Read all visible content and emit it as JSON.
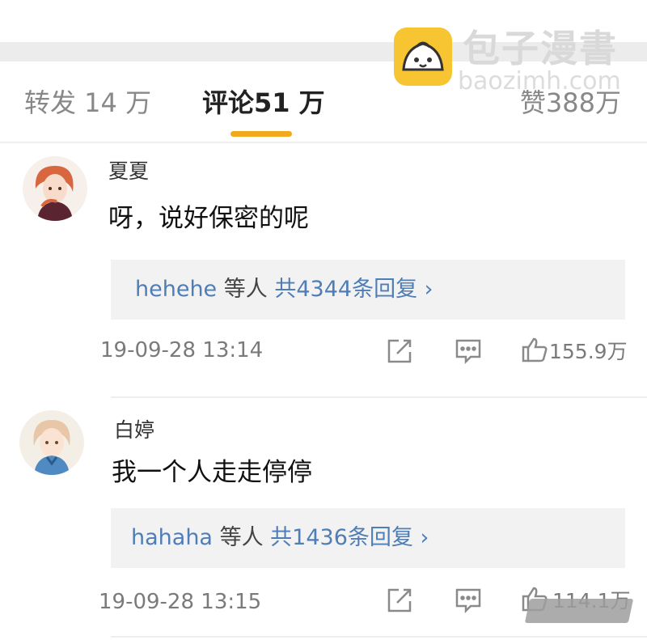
{
  "brand": {
    "name": "包子漫書",
    "url": "baozimh.com"
  },
  "tabs": [
    {
      "label": "转发 14 万"
    },
    {
      "label": "评论51 万"
    },
    {
      "label": "赞388万"
    }
  ],
  "comments": [
    {
      "username": "夏夏",
      "text": "呀，说好保密的呢",
      "replies": {
        "user": "hehehe",
        "others": "等人",
        "total": "共4344条回复",
        "chevron": "›"
      },
      "timestamp": "19-09-28  13:14",
      "likes": "155.9万"
    },
    {
      "username": "白婷",
      "text": "我一个人走走停停",
      "replies": {
        "user": "hahaha",
        "others": "等人",
        "total": "共1436条回复",
        "chevron": "›"
      },
      "timestamp": "19-09-28  13:15",
      "likes": "114.1万"
    }
  ],
  "colors": {
    "accent": "#f2a91d",
    "link": "#4f7db6",
    "logo": "#f6c531"
  },
  "icons": {
    "share": "share-icon",
    "reply": "reply-icon",
    "like": "thumbs-up-icon"
  }
}
